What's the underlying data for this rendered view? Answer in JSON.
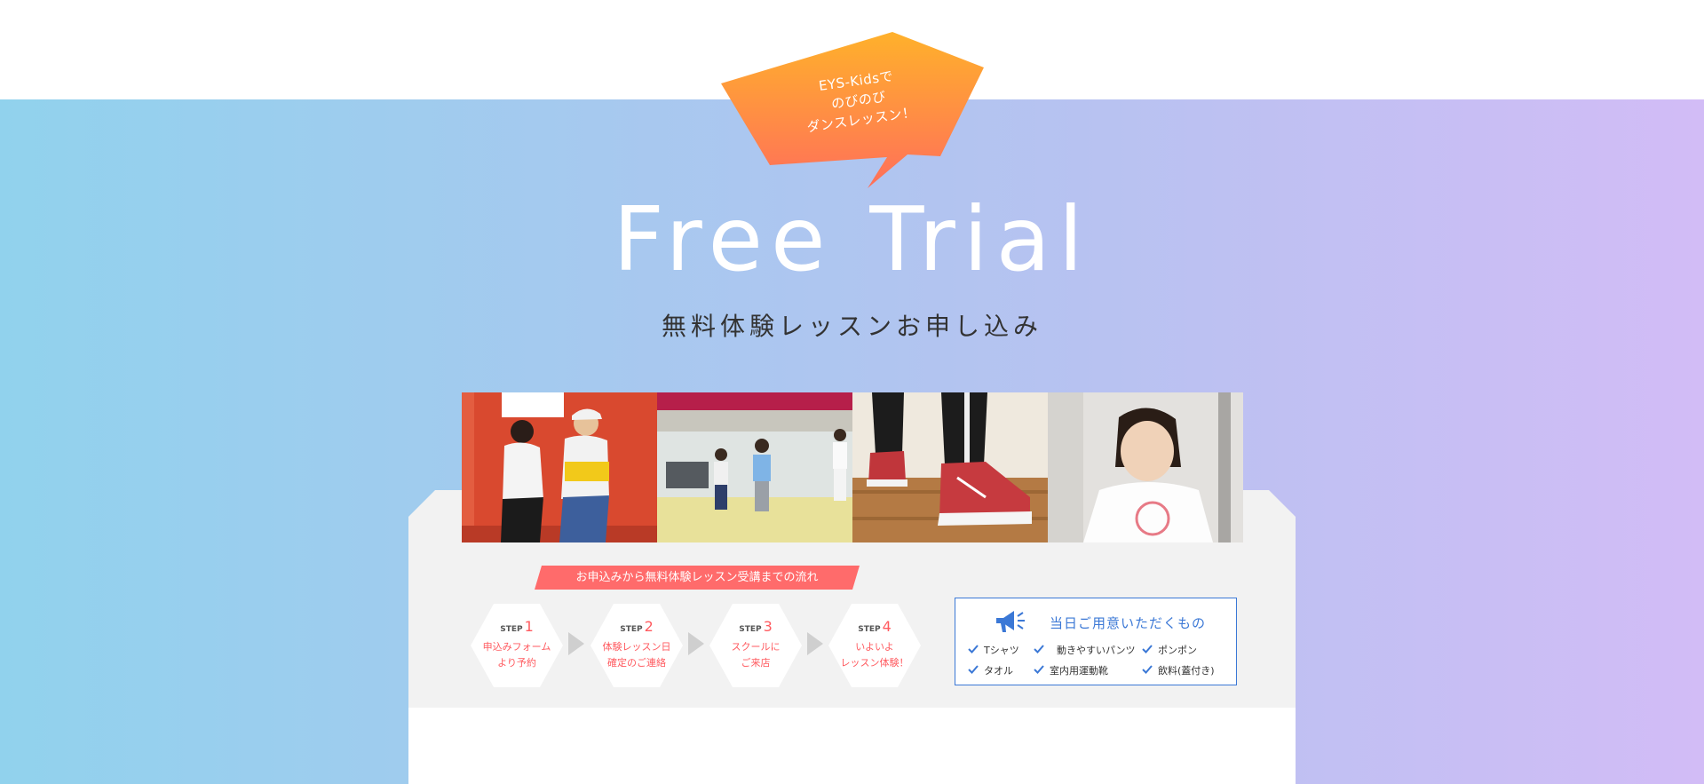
{
  "bubble": {
    "text": "EYS-Kidsで\nのびのび\nダンスレッスン！",
    "colors": [
      "#ffb12b",
      "#ff6f5a"
    ]
  },
  "title": "Free Trial",
  "subtitle": "無料体験レッスンお申し込み",
  "photos": [
    {
      "name": "photo-dancers-red-wall",
      "icon": "dancers-photo"
    },
    {
      "name": "photo-studio-kids",
      "icon": "studio-photo"
    },
    {
      "name": "photo-sneakers",
      "icon": "sneakers-photo"
    },
    {
      "name": "photo-girl-portrait",
      "icon": "portrait-photo"
    }
  ],
  "flow": {
    "label": "お申込みから無料体験レッスン受講までの流れ",
    "steps": [
      {
        "prefix": "STEP",
        "num": "1",
        "text": "申込みフォーム\nより予約"
      },
      {
        "prefix": "STEP",
        "num": "2",
        "text": "体験レッスン日\n確定のご連絡"
      },
      {
        "prefix": "STEP",
        "num": "3",
        "text": "スクールに\nご来店"
      },
      {
        "prefix": "STEP",
        "num": "4",
        "text": "いよいよ\nレッスン体験！"
      }
    ]
  },
  "items": {
    "title": "当日ご用意いただくもの",
    "icon": "megaphone-icon",
    "list": [
      "Tシャツ",
      "動きやすいパンツ",
      "ポンポン",
      "タオル",
      "室内用運動靴",
      "飲料(蓋付き)"
    ]
  },
  "colors": {
    "accent": "#ff6b6b",
    "blue": "#3b78d6"
  }
}
